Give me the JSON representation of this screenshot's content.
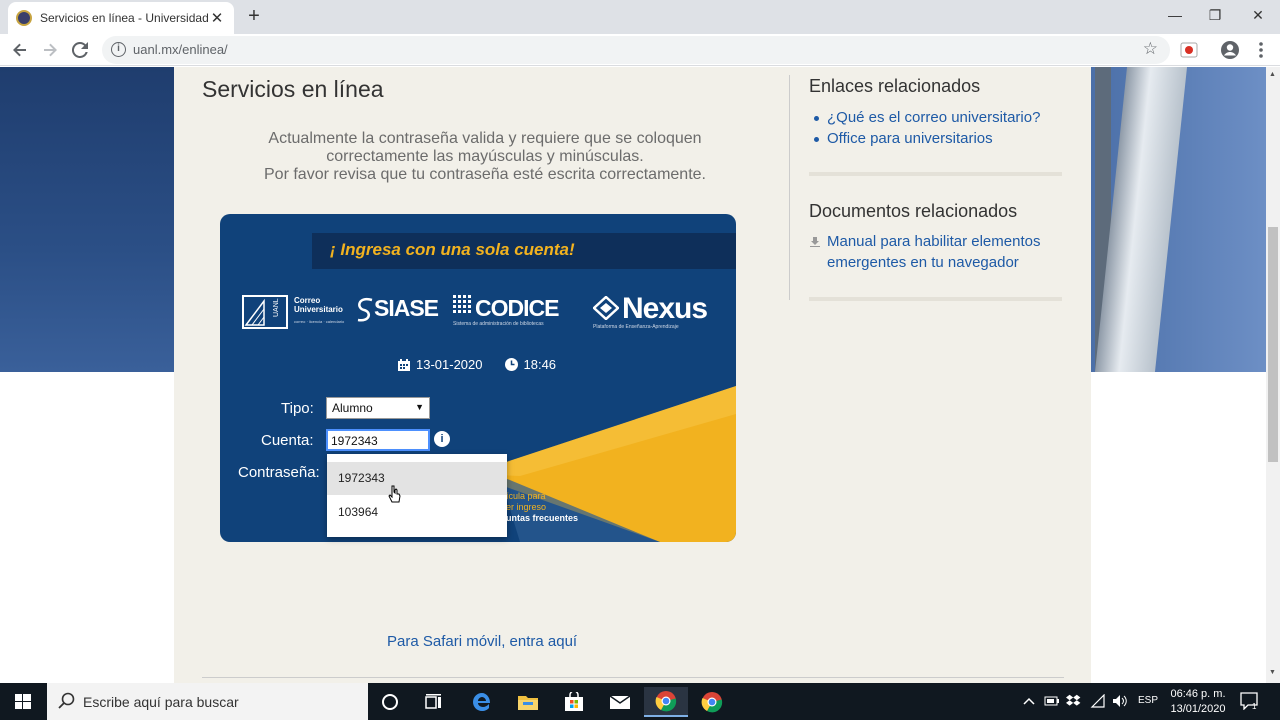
{
  "browser": {
    "tab_title": "Servicios en línea - Universidad A",
    "tab_close": "✕",
    "new_tab": "+",
    "url": "uanl.mx/enlinea/",
    "window_controls": {
      "minimize": "—",
      "maximize": "❐",
      "close": "✕"
    }
  },
  "page": {
    "title": "Servicios en línea",
    "notice_line1": "Actualmente la contraseña valida y requiere que se coloquen",
    "notice_line2": "correctamente las mayúsculas y minúsculas.",
    "notice_line3": "Por favor revisa que tu contraseña esté escrita correctamente.",
    "safari_link": "Para Safari móvil, entra aquí"
  },
  "login": {
    "banner": "¡ Ingresa con una sola cuenta!",
    "logos": {
      "correo": "Correo Universitario",
      "correo_sub": "correo · licencia · calendario",
      "siase": "SIASE",
      "codice": "CODICE",
      "codice_sub": "Sistema de administración de bibliotecas",
      "nexus": "Nexus",
      "nexus_sub": "Plataforma de Enseñanza-Aprendizaje",
      "uanl_mark": "UANL"
    },
    "date": "13-01-2020",
    "time": "18:46",
    "tipo_label": "Tipo:",
    "tipo_value": "Alumno",
    "cuenta_label": "Cuenta:",
    "cuenta_value": "1972343",
    "password_label": "Contraseña:",
    "help_line1": "ícula para",
    "help_line2": "er ingreso",
    "help_line3": "untas frecuentes",
    "autocomplete": [
      "1972343",
      "103964"
    ]
  },
  "sidebar": {
    "related_links_heading": "Enlaces relacionados",
    "link1": "¿Qué es el correo universitario?",
    "link2": "Office para universitarios",
    "related_docs_heading": "Documentos relacionados",
    "doc1_line1": "Manual para habilitar elementos",
    "doc1_line2": "emergentes en tu navegador"
  },
  "taskbar": {
    "search_placeholder": "Escribe aquí para buscar",
    "language": "ESP",
    "time": "06:46 p. m.",
    "date": "13/01/2020",
    "notifications": "1"
  },
  "colors": {
    "card_blue": "#10427a",
    "accent_yellow": "#f2b21f",
    "link_blue": "#1e5aa6"
  }
}
